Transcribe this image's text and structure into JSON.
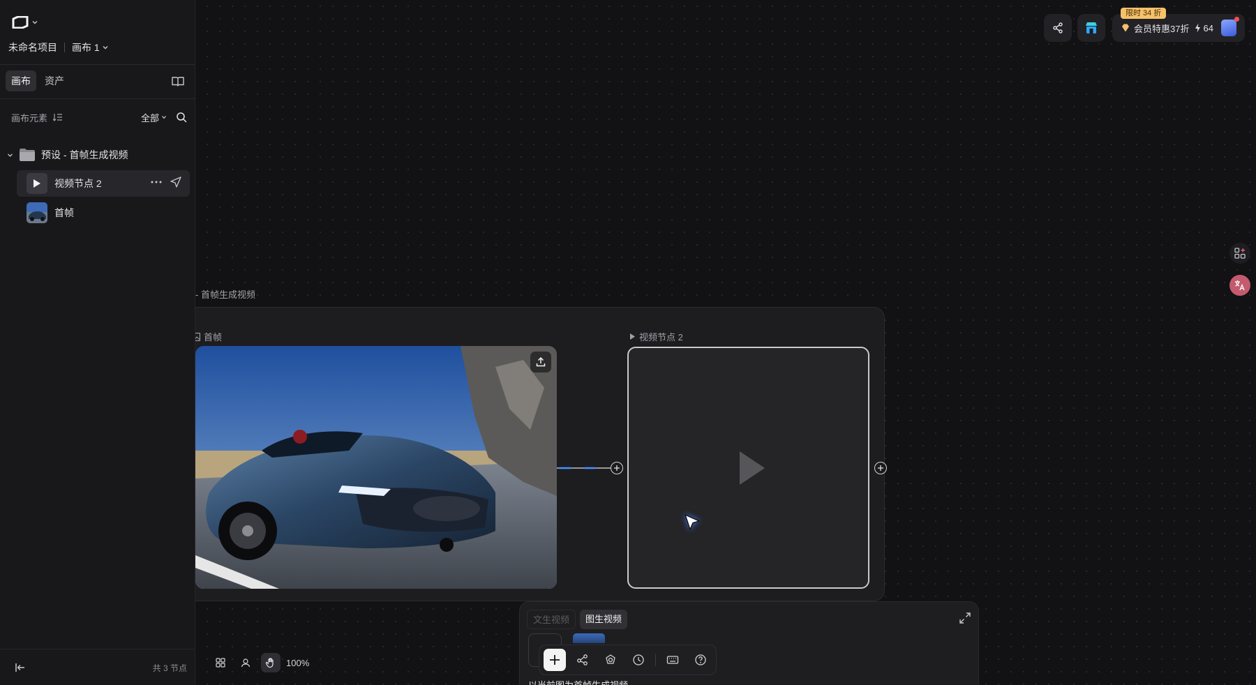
{
  "app": {
    "project_name": "未命名项目",
    "canvas_name": "画布 1"
  },
  "sidebar": {
    "tabs": [
      {
        "label": "画布",
        "active": true
      },
      {
        "label": "资产",
        "active": false
      }
    ],
    "filter": {
      "title": "画布元素",
      "scope": "全部"
    },
    "tree": {
      "group_label": "预设 - 首帧生成视频",
      "items": [
        {
          "label": "视频节点 2",
          "selected": true,
          "icon": "play-icon"
        },
        {
          "label": "首帧",
          "selected": false,
          "icon": "image-thumbnail"
        }
      ]
    },
    "footer": {
      "node_count": "共 3 节点"
    }
  },
  "topbar": {
    "promo_tag": "限时 34 折",
    "member_text": "会员特惠37折",
    "credits": "64",
    "icons": [
      "share-icon",
      "store-icon",
      "diamond-icon",
      "bolt-icon"
    ]
  },
  "canvas": {
    "group_title": "- 首帧生成视频",
    "image_node_label": "首帧",
    "video_node_label": "视频节点 2"
  },
  "generator": {
    "tabs": [
      {
        "label": "文生视频",
        "enabled": false
      },
      {
        "label": "图生视频",
        "enabled": true,
        "active": true
      }
    ],
    "prompt": "以当前图为首帧生成视频"
  },
  "zoom": {
    "level": "100%"
  },
  "colors": {
    "background": "#121214",
    "sidebar": "#18181b",
    "accent_blue": "#4a90ff",
    "promo": "#f5c26b",
    "store_icon": "#3fd0e0"
  }
}
